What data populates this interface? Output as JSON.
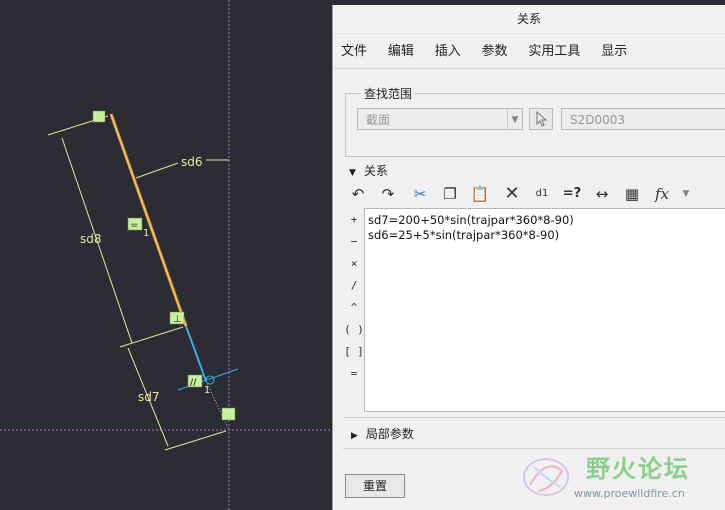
{
  "dialog": {
    "title": "关系",
    "menu": [
      "文件",
      "编辑",
      "插入",
      "参数",
      "实用工具",
      "显示"
    ],
    "scope": {
      "legend": "查找范围",
      "type_value": "截面",
      "object_value": "S2D0003"
    },
    "relations": {
      "header": "关系",
      "lines": [
        "sd7=200+50*sin(trajpar*360*8-90)",
        "sd6=25+5*sin(trajpar*360*8-90)"
      ],
      "toolbar_icons": [
        "undo-icon",
        "redo-icon",
        "cut-icon",
        "copy-icon",
        "paste-icon",
        "delete-icon",
        "switch-dims-icon",
        "evaluate-icon",
        "measure-icon",
        "local-params-icon",
        "function-icon"
      ],
      "toolbar_glyphs": {
        "eval": "=?",
        "fx": "fx"
      },
      "operators": [
        "+",
        "−",
        "×",
        "/",
        "^",
        "( )",
        "[ ]",
        "="
      ]
    },
    "local_params": "局部参数",
    "reset_button": "重置"
  },
  "sketch": {
    "dimensions": [
      "sd6",
      "sd8",
      "sd7"
    ]
  },
  "watermark": {
    "title": "野火论坛",
    "url": "www.proewildfire.cn"
  },
  "colors": {
    "sketch_bg": "#2c2c34",
    "dimension": "#e8e6a0",
    "highlight_line": "#e09a30",
    "blue_line": "#3aa8e8",
    "constraint_box": "#c8f0a0",
    "axis": "#b070d0"
  }
}
